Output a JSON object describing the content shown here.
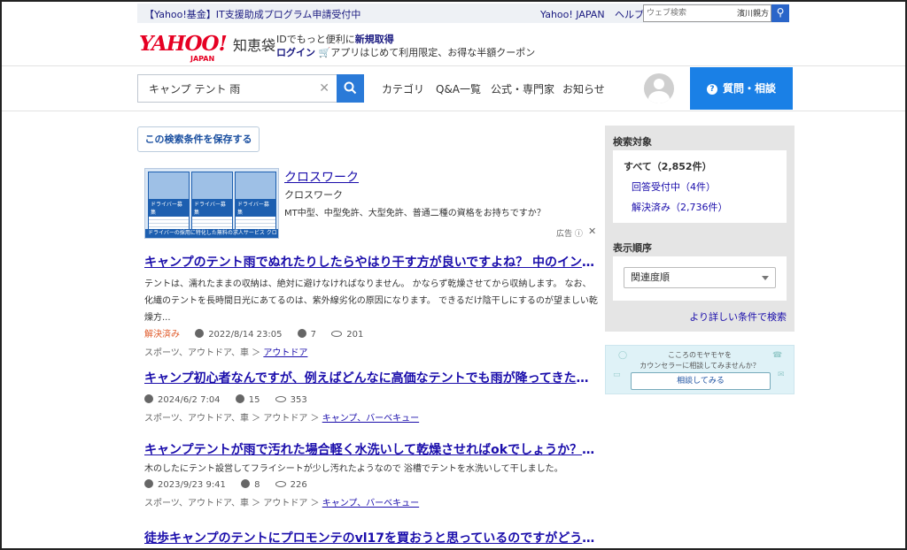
{
  "topbar": {
    "promo": "【Yahoo!基金】IT支援助成プログラム申請受付中",
    "links": [
      "Yahoo! JAPAN",
      "ヘルプ"
    ],
    "websearch_placeholder": "ウェブ検索",
    "websearch_badge": "濱川親方"
  },
  "logo": {
    "yahoo": "YAHOO!",
    "japan": "JAPAN",
    "service": "知恵袋"
  },
  "promo": {
    "line1_prefix": "IDでもっと便利に",
    "line1_link": "新規取得",
    "line2_login": "ログイン",
    "line2_text": "アプリはじめて利用限定、お得な半額クーポン"
  },
  "search": {
    "value": "キャンプ テント 雨"
  },
  "nav": [
    "カテゴリ",
    "Q&A一覧",
    "公式・専門家",
    "お知らせ"
  ],
  "ask_button": "質問・相談",
  "save_condition": "この検索条件を保存する",
  "ad": {
    "title": "クロスワーク",
    "sponsor": "クロスワーク",
    "description": "MT中型、中型免許、大型免許、普通二種の資格をお持ちですか？",
    "label": "広告",
    "panels": [
      "ドライバー募集",
      "ドライバー募集",
      "ドライバー募集"
    ],
    "strip": "ドライバーの採用に特化した無料の求人サービス クロスワーク"
  },
  "results": [
    {
      "title": "キャンプのテント雨でぬれたりしたらやはり干す方が良いですよね？ 中のインナーテントの方も",
      "snippet": "テントは、濡れたままの収納は、絶対に避けなければなりません。 かならず乾燥させてから収納します。 なお、化繊のテントを長時間日光にあてるのは、紫外線劣化の原因になります。 できるだけ陰干しにするのが望ましい乾燥方...",
      "status": "解決済み",
      "date": "2022/8/14 23:05",
      "answers": "7",
      "views": "201",
      "category_path": "スポーツ、アウトドア、車 ＞",
      "category_link": "アウトドア"
    },
    {
      "title": "キャンプ初心者なんですが、例えばどんなに高価なテントでも雨が降ってきたら濡れますよね？",
      "snippet": "",
      "status": "",
      "date": "2024/6/2 7:04",
      "answers": "15",
      "views": "353",
      "category_path": "スポーツ、アウトドア、車 ＞ アウトドア ＞",
      "category_link": "キャンプ、バーベキュー"
    },
    {
      "title": "キャンプテントが雨で汚れた場合軽く水洗いして乾燥させればokでしょうか？ 一回目の使用で",
      "snippet": "木のしたにテント設営してフライシートが少し汚れたようなので 浴槽でテントを水洗いして干しました。",
      "status": "",
      "date": "2023/9/23 9:41",
      "answers": "8",
      "views": "226",
      "category_path": "スポーツ、アウトドア、車 ＞ アウトドア ＞",
      "category_link": "キャンプ、バーベキュー"
    },
    {
      "title": "徒歩キャンプのテントにプロモンテのvl17を買おうと思っているのですがどうでしょうか",
      "snippet": "",
      "status": "",
      "date": "",
      "answers": "",
      "views": "",
      "category_path": "",
      "category_link": ""
    }
  ],
  "sidebar": {
    "target_heading": "検索対象",
    "all": "すべて（2,852件）",
    "open": "回答受付中（4件）",
    "solved": "解決済み（2,736件）",
    "order_heading": "表示順序",
    "order_value": "関連度順",
    "more_link": "より詳しい条件で検索"
  },
  "counsel": {
    "line1": "こころのモヤモヤを",
    "line2": "カウンセラーに相談してみませんか？",
    "button": "相談してみる"
  }
}
